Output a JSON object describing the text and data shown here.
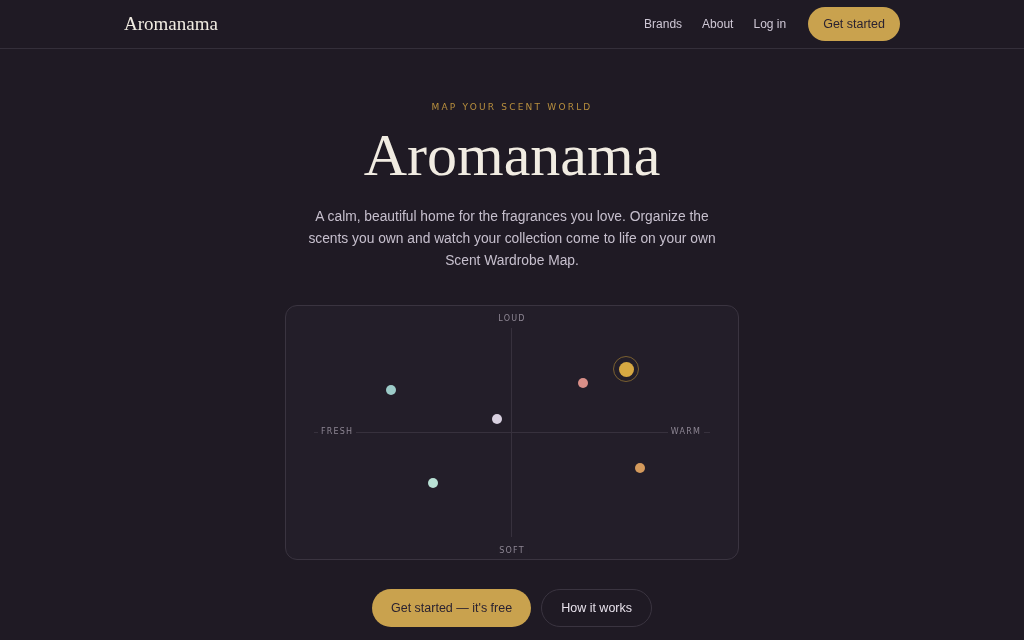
{
  "header": {
    "logo": "Aromanama",
    "nav": [
      {
        "label": "Brands"
      },
      {
        "label": "About"
      },
      {
        "label": "Log in"
      }
    ],
    "cta": "Get started"
  },
  "hero": {
    "eyebrow": "MAP YOUR SCENT WORLD",
    "title": "Aromanama",
    "description": "A calm, beautiful home for the fragrances you love. Organize the scents you own and watch your collection come to life on your own Scent Wardrobe Map."
  },
  "map": {
    "axis_top": "LOUD",
    "axis_bottom": "SOFT",
    "axis_left": "FRESH",
    "axis_right": "WARM",
    "dots": [
      {
        "color": "#9ccbc8",
        "selected": false
      },
      {
        "color": "#d8d0e0",
        "selected": false
      },
      {
        "color": "#b8e0d4",
        "selected": false
      },
      {
        "color": "#d98f88",
        "selected": false
      },
      {
        "color": "#d6a842",
        "selected": true
      },
      {
        "color": "#d49a5c",
        "selected": false
      }
    ]
  },
  "actions": [
    {
      "label": "Get started — it's free",
      "kind": "primary"
    },
    {
      "label": "How it works",
      "kind": "secondary"
    }
  ]
}
